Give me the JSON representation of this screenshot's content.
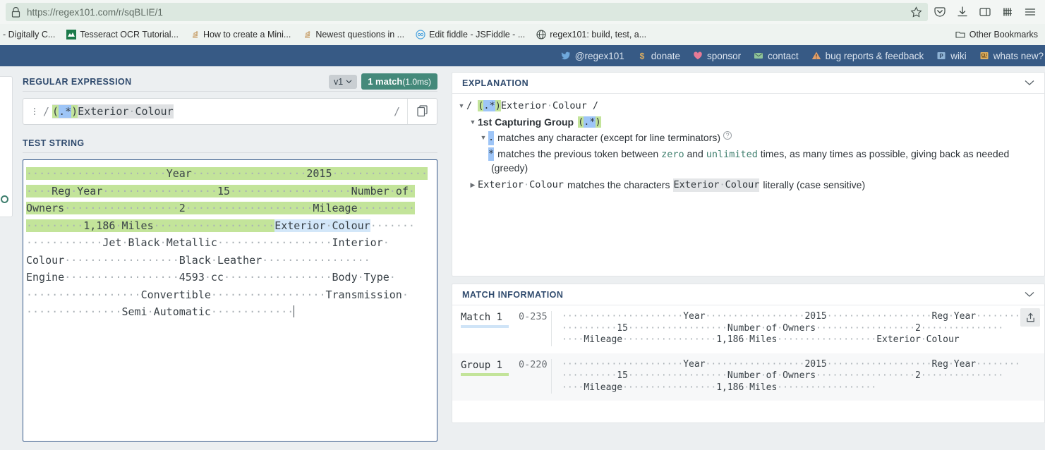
{
  "browser": {
    "url": "https://regex101.com/r/sqBLIE/1",
    "lock_icon": "padlock-icon",
    "star_icon": "bookmark-star-icon",
    "toolbar_icons": [
      "pocket-icon",
      "downloads-icon",
      "sidebar-icon",
      "library-icon",
      "hamburger-menu-icon"
    ],
    "bookmarks": [
      {
        "label": "- Digitally C...",
        "icon": "page-icon"
      },
      {
        "label": "Tesseract OCR Tutorial...",
        "icon": "tesseract-icon"
      },
      {
        "label": "How to create a Mini...",
        "icon": "stackoverflow-icon"
      },
      {
        "label": "Newest questions in ...",
        "icon": "stackoverflow-icon"
      },
      {
        "label": "Edit fiddle - JSFiddle - ...",
        "icon": "jsfiddle-icon"
      },
      {
        "label": "regex101: build, test, a...",
        "icon": "globe-icon"
      }
    ],
    "other_bookmarks": {
      "label": "Other Bookmarks",
      "icon": "folder-icon"
    }
  },
  "navbar": {
    "items": [
      {
        "label": "@regex101",
        "icon": "twitter-icon"
      },
      {
        "label": "donate",
        "icon": "dollar-icon"
      },
      {
        "label": "sponsor",
        "icon": "heart-icon"
      },
      {
        "label": "contact",
        "icon": "mail-icon"
      },
      {
        "label": "bug reports & feedback",
        "icon": "warning-icon"
      },
      {
        "label": "wiki",
        "icon": "wiki-icon"
      },
      {
        "label": "whats new?",
        "icon": "news-icon"
      }
    ]
  },
  "regex_section": {
    "title": "REGULAR EXPRESSION",
    "version": "v1",
    "version_caret_icon": "chevron-down-icon",
    "match_count": "1 match",
    "match_time": "(1.0ms)",
    "drag_handle_icon": "drag-handle-icon",
    "open_slash": "/",
    "close_slash": "/",
    "copy_icon": "copy-icon",
    "pattern_tokens": [
      {
        "text": "(",
        "style": "paren"
      },
      {
        "text": ".",
        "style": "dotstar"
      },
      {
        "text": "*",
        "style": "dotstar"
      },
      {
        "text": ")",
        "style": "paren"
      },
      {
        "text": "Exterior",
        "style": "plain"
      },
      {
        "text": "·",
        "style": "dot"
      },
      {
        "text": "Colour",
        "style": "plain"
      }
    ]
  },
  "test_string": {
    "title": "TEST STRING",
    "lines": [
      [
        {
          "t": "······················Year··················2015···············",
          "h": "green"
        }
      ],
      [
        {
          "t": "····Reg·Year··················15···················Number·of·",
          "h": "green"
        }
      ],
      [
        {
          "t": "Owners··················2····················Mileage·········",
          "h": "green"
        }
      ],
      [
        {
          "t": "·········1,186·Miles···················",
          "h": "green"
        },
        {
          "t": "Exterior·Colour",
          "h": "blue"
        },
        {
          "t": "·······",
          "h": "none"
        }
      ],
      [
        {
          "t": "············Jet·Black·Metallic··················Interior·",
          "h": "none"
        }
      ],
      [
        {
          "t": "Colour··················Black·Leather·················",
          "h": "none"
        }
      ],
      [
        {
          "t": "Engine··················4593·cc·················Body·Type·",
          "h": "none"
        }
      ],
      [
        {
          "t": "··················Convertible··················Transmission·",
          "h": "none"
        }
      ],
      [
        {
          "t": "···············Semi·Automatic·············",
          "h": "none"
        }
      ]
    ]
  },
  "explanation": {
    "title": "EXPLANATION",
    "collapse_icon": "chevron-down-icon",
    "root": {
      "open_slash": "/",
      "close_slash": "/",
      "pattern_plain": "Exterior·Colour"
    },
    "group": {
      "label": "1st Capturing Group",
      "pattern": "(.*)"
    },
    "dot_rule": {
      "token": ".",
      "text": "matches any character (except for line terminators)",
      "help_icon": "help-circle-icon"
    },
    "star_rule": {
      "token": "*",
      "text_a": "matches the previous token between",
      "kw_zero": "zero",
      "text_and": "and",
      "kw_unlimited": "unlimited",
      "text_b": "times, as many times as possible, giving back as needed",
      "text_c": "(greedy)"
    },
    "literal_rule": {
      "token": "Exterior·Colour",
      "text_a": "matches the characters",
      "token2": "Exterior·Colour",
      "text_b": "literally (case sensitive)"
    }
  },
  "match_info": {
    "title": "MATCH INFORMATION",
    "collapse_icon": "chevron-down-icon",
    "export_icon": "export-share-icon",
    "rows": [
      {
        "name": "Match 1",
        "range": "0-235",
        "underline": "blue",
        "value_lines": [
          "······················Year··················2015···················Reg·Year········",
          "··········15··················Number·of·Owners··················2···············",
          "····Mileage·················1,186·Miles··················Exterior·Colour"
        ]
      },
      {
        "name": "Group 1",
        "range": "0-220",
        "underline": "green",
        "value_lines": [
          "······················Year··················2015···················Reg·Year········",
          "··········15··················Number·of·Owners··················2···············",
          "····Mileage·················1,186·Miles··················"
        ]
      }
    ]
  },
  "colors": {
    "navbar_blue": "#375a85",
    "match_badge_green": "#44897a",
    "group_highlight_green": "#c3e49a",
    "match_highlight_blue": "#d3e7f9",
    "section_title_blue": "#2f4a6d"
  }
}
